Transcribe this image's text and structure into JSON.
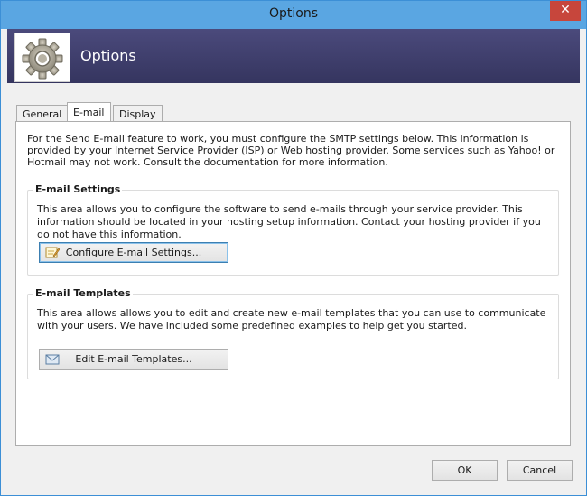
{
  "window": {
    "title": "Options",
    "close_glyph": "✕"
  },
  "banner": {
    "title": "Options",
    "icon": "gear-icon"
  },
  "tabs": [
    {
      "label": "General",
      "active": false
    },
    {
      "label": "E-mail",
      "active": true
    },
    {
      "label": "Display",
      "active": false
    }
  ],
  "email_tab": {
    "intro": "For the Send E-mail feature to work, you must configure the SMTP settings below. This information is provided by your Internet Service Provider (ISP) or Web hosting provider. Some services such as Yahoo! or Hotmail may not work. Consult the documentation for more information.",
    "settings_group": {
      "title": "E-mail Settings",
      "text": "This area allows you to configure the software to send e-mails through your service provider. This information should be located in your hosting setup information. Contact your hosting provider if you do not have this information.",
      "button_label": "Configure E-mail Settings...",
      "button_icon": "edit-icon"
    },
    "templates_group": {
      "title": "E-mail Templates",
      "text": "This area allows allows you to edit and create new e-mail templates that you can use to communicate with your users. We have included some predefined examples to help get you started.",
      "button_label": "Edit E-mail Templates...",
      "button_icon": "envelope-icon"
    }
  },
  "footer": {
    "ok_label": "OK",
    "cancel_label": "Cancel"
  }
}
